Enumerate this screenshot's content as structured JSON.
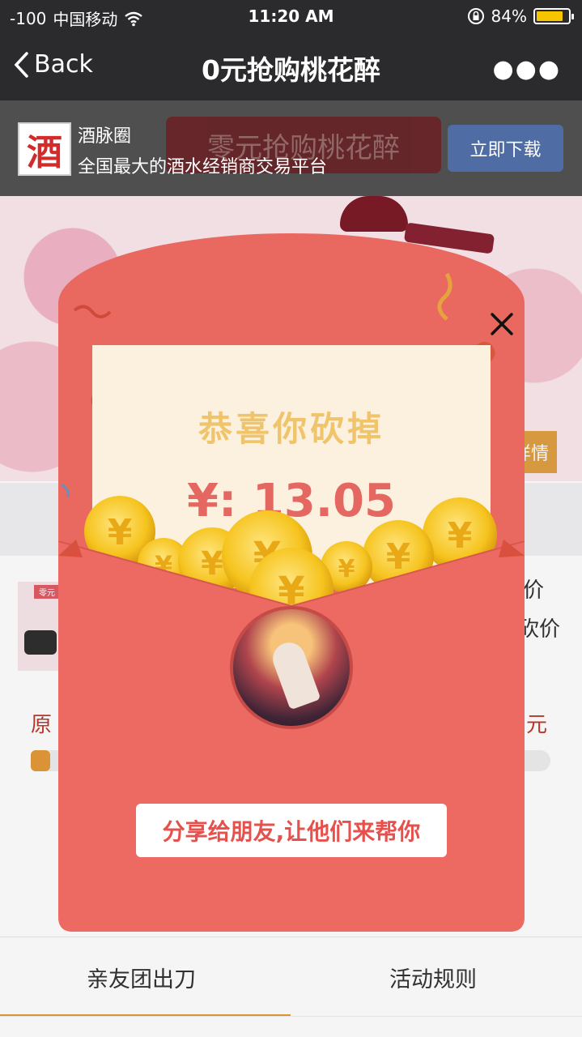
{
  "status_bar": {
    "signal": "-100",
    "carrier": "中国移动",
    "time": "11:20 AM",
    "battery": "84%",
    "battery_level": 0.84
  },
  "nav": {
    "back_label": "Back",
    "title": "0元抢购桃花醉"
  },
  "app_banner": {
    "logo_glyph": "酒",
    "name": "酒脉圈",
    "description": "全国最大的酒水经销商交易平台",
    "download_label": "立即下载",
    "background_title": "零元抢购桃花醉"
  },
  "background": {
    "detail_label": "详情",
    "product_tag": "零元",
    "price_label_1": "价",
    "price_label_2": "砍价",
    "original_price_label": "原",
    "yuan_label": "元",
    "progress": 0.035
  },
  "modal": {
    "congrats": "恭喜你砍掉",
    "amount": "¥: 13.05",
    "share_label": "分享给朋友,让他们来帮你"
  },
  "tabs": [
    {
      "label": "亲友团出刀"
    },
    {
      "label": "活动规则"
    }
  ],
  "colors": {
    "envelope": "#e96860",
    "letter": "#fbf1de",
    "congrats_text": "#f0c46a",
    "amount_text": "#e46762",
    "accent": "#e4993a",
    "download": "#4f6ca5"
  }
}
